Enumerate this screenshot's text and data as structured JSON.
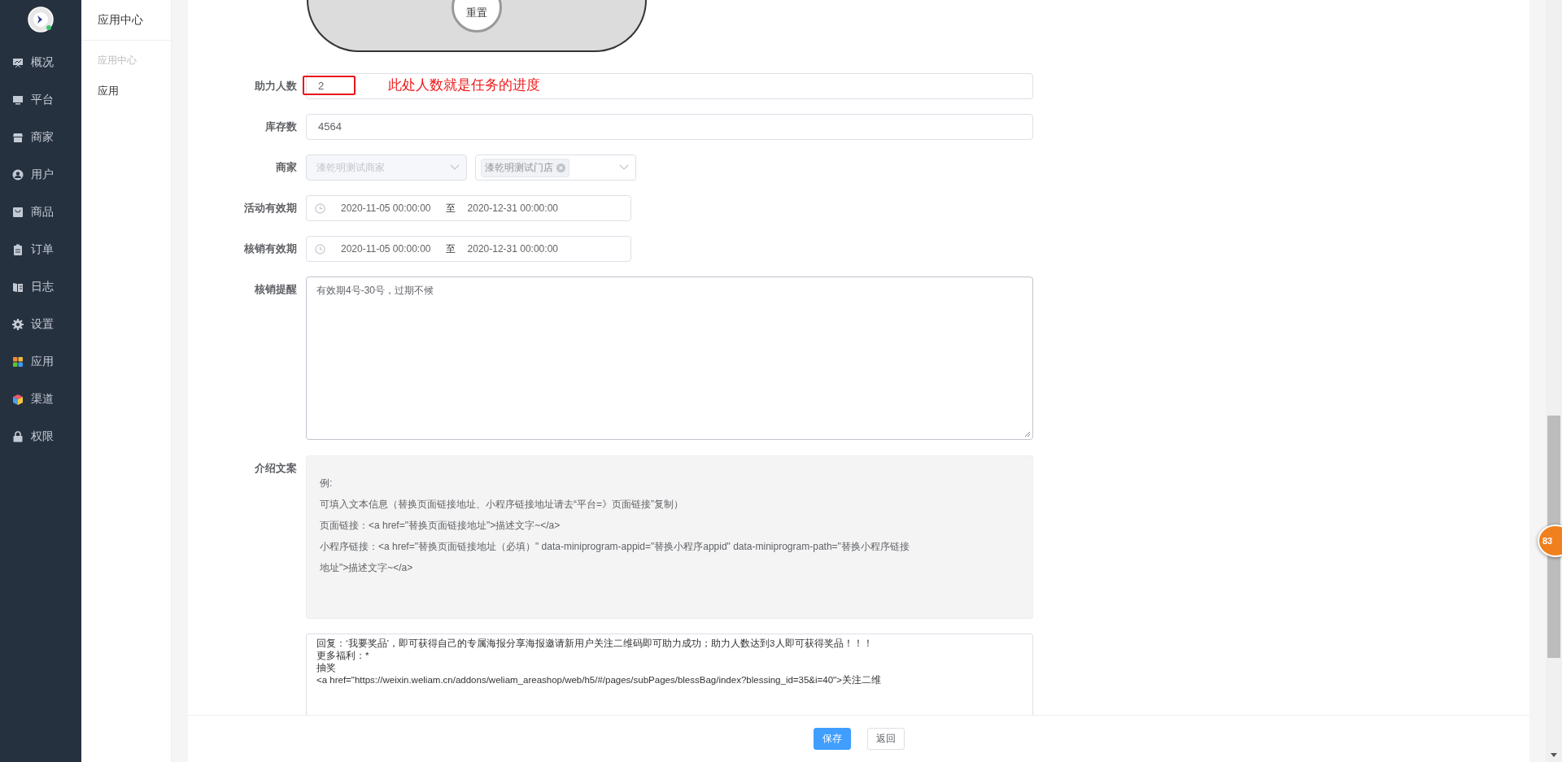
{
  "sidebar": {
    "items": [
      {
        "label": "概况"
      },
      {
        "label": "平台"
      },
      {
        "label": "商家"
      },
      {
        "label": "用户"
      },
      {
        "label": "商品"
      },
      {
        "label": "订单"
      },
      {
        "label": "日志"
      },
      {
        "label": "设置"
      },
      {
        "label": "应用"
      },
      {
        "label": "渠道"
      },
      {
        "label": "权限"
      }
    ]
  },
  "subnav": {
    "title": "应用中心",
    "group": "应用中心",
    "items": [
      {
        "label": "应用"
      }
    ]
  },
  "preview": {
    "reset_button": "重置"
  },
  "form": {
    "fields": [
      {
        "kind": "input",
        "label": "助力人数",
        "value": "2",
        "annotation": "此处人数就是任务的进度"
      },
      {
        "kind": "input",
        "label": "库存数",
        "value": "4564"
      },
      {
        "kind": "selects",
        "label": "商家",
        "selects": [
          {
            "value": "漆乾明测试商家",
            "disabled": true
          },
          {
            "tags": [
              "漆乾明测试门店"
            ]
          }
        ]
      },
      {
        "kind": "daterange",
        "label": "活动有效期",
        "start": "2020-11-05 00:00:00",
        "separator": "至",
        "end": "2020-12-31 00:00:00"
      },
      {
        "kind": "daterange",
        "label": "核销有效期",
        "start": "2020-11-05 00:00:00",
        "separator": "至",
        "end": "2020-12-31 00:00:00"
      },
      {
        "kind": "textarea",
        "label": "核销提醒",
        "value": "有效期4号-30号，过期不候"
      },
      {
        "kind": "hint",
        "label": "介绍文案",
        "lines": [
          "例:",
          "可填入文本信息（替换页面链接地址、小程序链接地址请去“平台=》页面链接”复制）",
          "页面链接：<a href=\"替换页面链接地址\">描述文字~</a>",
          "小程序链接：<a href=\"替换页面链接地址（必填）\" data-miniprogram-appid=\"替换小程序appid\" data-miniprogram-path=\"替换小程序链接",
          "地址\">描述文字~</a>"
        ]
      },
      {
        "kind": "editor",
        "lines": [
          "回复：‘我要奖品’，即可获得自己的专属海报分享海报邀请新用户关注二维码即可助力成功；助力人数达到3人即可获得奖品！！！",
          "更多福利：*",
          "抽奖",
          "<a href=\"https://weixin.weliam.cn/addons/weliam_areashop/web/h5/#/pages/subPages/blessBag/index?blessing_id=35&i=40\">关注二维"
        ]
      }
    ]
  },
  "footer": {
    "buttons": [
      {
        "label": "保存",
        "kind": "primary"
      },
      {
        "label": "返回",
        "kind": "default"
      }
    ]
  },
  "badge": {
    "text": "83"
  }
}
